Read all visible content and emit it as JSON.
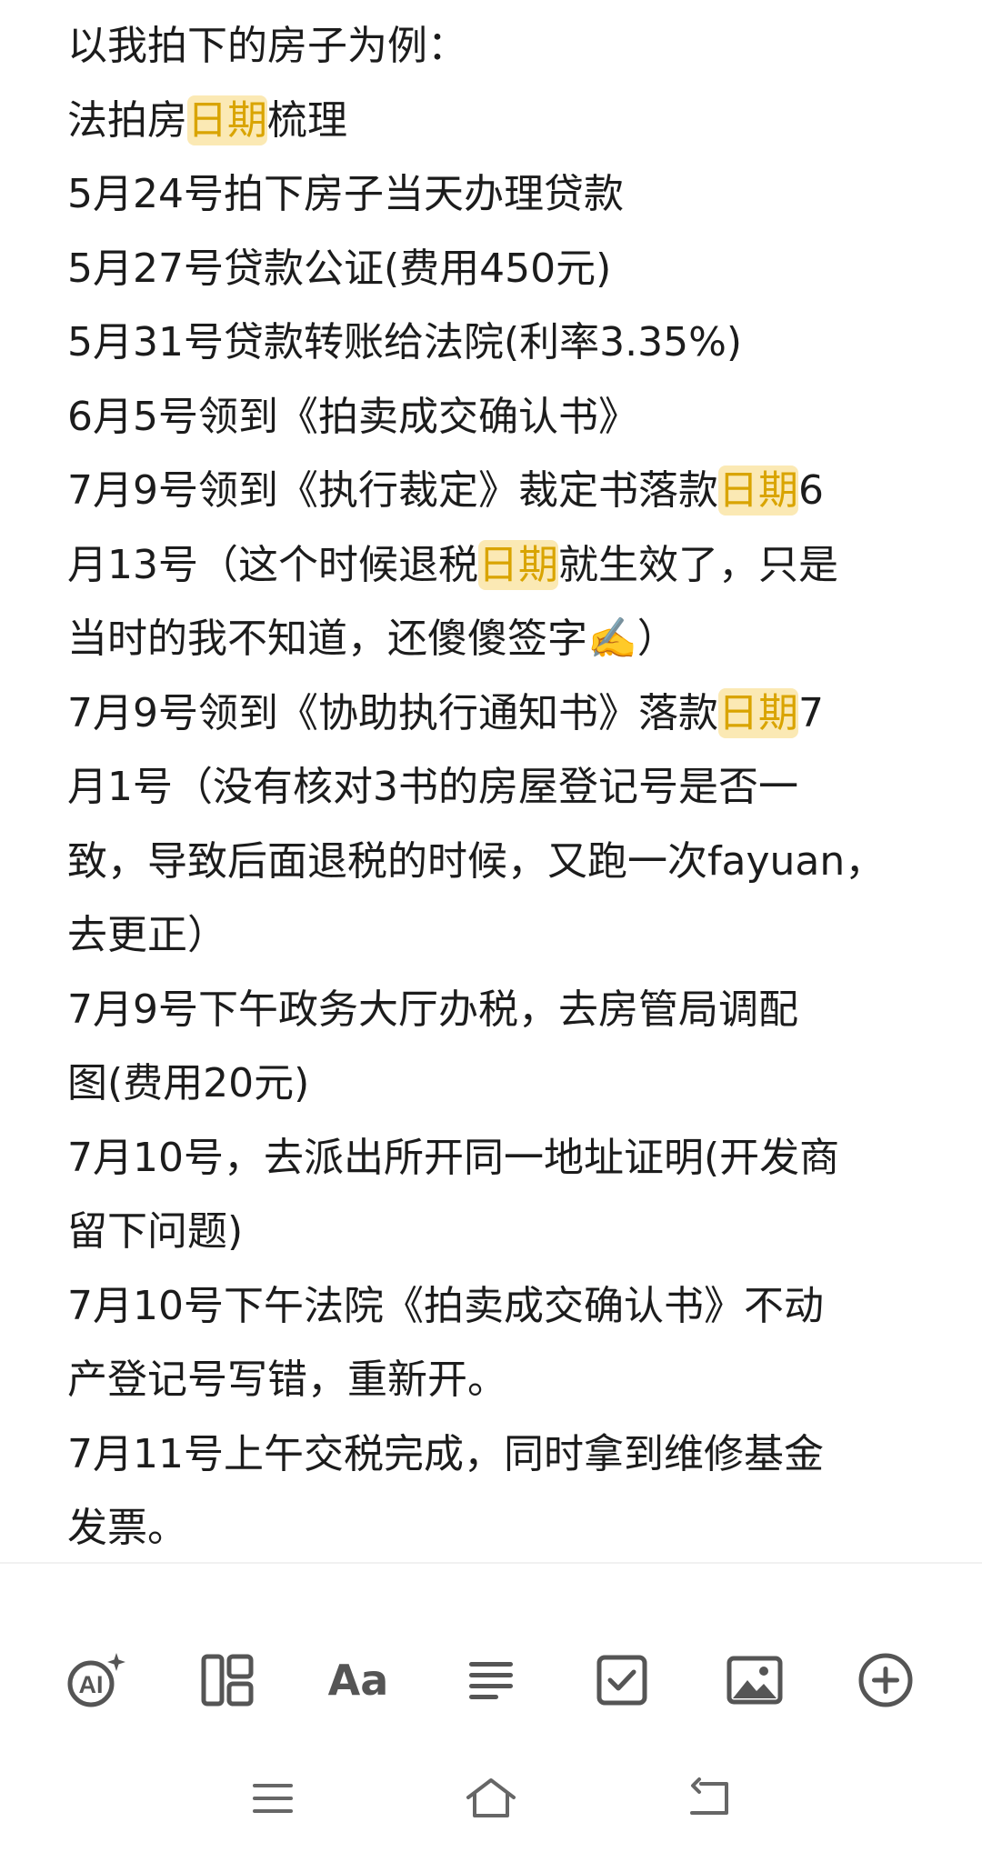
{
  "note": {
    "lines": [
      [
        {
          "t": "以我拍下的房子为例："
        }
      ],
      [
        {
          "t": "法拍房"
        },
        {
          "t": "日期",
          "hl": true
        },
        {
          "t": "梳理"
        }
      ],
      [
        {
          "t": "5月24号拍下房子当天办理贷款"
        }
      ],
      [
        {
          "t": "5月27号贷款公证(费用450元)"
        }
      ],
      [
        {
          "t": "5月31号贷款转账给法院(利率3.35%)"
        }
      ],
      [
        {
          "t": "6月5号领到《拍卖成交确认书》"
        }
      ],
      [
        {
          "t": "7月9号领到《执行裁定》裁定书落款"
        },
        {
          "t": "日期",
          "hl": true
        },
        {
          "t": "6"
        }
      ],
      [
        {
          "t": "月13号（这个时候退税"
        },
        {
          "t": "日期",
          "hl": true
        },
        {
          "t": "就生效了，只是"
        }
      ],
      [
        {
          "t": "当时的我不知道，还傻傻签字✍️）"
        }
      ],
      [
        {
          "t": "7月9号领到《协助执行通知书》落款"
        },
        {
          "t": "日期",
          "hl": true
        },
        {
          "t": "7"
        }
      ],
      [
        {
          "t": "月1号（没有核对3书的房屋登记号是否一"
        }
      ],
      [
        {
          "t": "致，导致后面退税的时候，又跑一次fayuan，"
        }
      ],
      [
        {
          "t": "去更正）"
        }
      ],
      [
        {
          "t": "7月9号下午政务大厅办税，去房管局调配"
        }
      ],
      [
        {
          "t": "图(费用20元)"
        }
      ],
      [
        {
          "t": "7月10号，去派出所开同一地址证明(开发商"
        }
      ],
      [
        {
          "t": "留下问题)"
        }
      ],
      [
        {
          "t": "7月10号下午法院《拍卖成交确认书》不动"
        }
      ],
      [
        {
          "t": "产登记号写错，重新开。"
        }
      ],
      [
        {
          "t": "7月11号上午交税完成，同时拿到维修基金"
        }
      ],
      [
        {
          "t": "发票。"
        }
      ]
    ]
  },
  "toolbar": {
    "items": [
      {
        "name": "ai-assistant-button",
        "icon": "ai-sparkle-icon"
      },
      {
        "name": "layout-template-button",
        "icon": "layout-grid-icon"
      },
      {
        "name": "text-style-button",
        "icon": "text-style-icon",
        "label": "Aa"
      },
      {
        "name": "paragraph-align-button",
        "icon": "align-left-icon"
      },
      {
        "name": "checklist-button",
        "icon": "checkbox-icon"
      },
      {
        "name": "insert-image-button",
        "icon": "image-icon"
      },
      {
        "name": "insert-more-button",
        "icon": "plus-circle-icon"
      }
    ]
  },
  "navigation": {
    "items": [
      {
        "name": "recent-apps-button",
        "icon": "menu-lines-icon"
      },
      {
        "name": "home-button",
        "icon": "home-icon"
      },
      {
        "name": "back-button",
        "icon": "back-arrow-icon"
      }
    ]
  },
  "colors": {
    "text": "#1c1c1c",
    "highlight_bg": "#fbe9b4",
    "highlight_text": "#d9a400",
    "icon": "#555555"
  }
}
